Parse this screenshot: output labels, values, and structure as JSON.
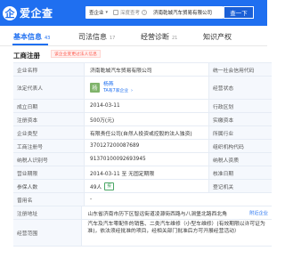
{
  "header": {
    "logo_mark": "企",
    "logo_text": "爱企查",
    "scope_label": "查企业",
    "deep_search_label": "深度查考",
    "search_value": "济南乾城汽车贸易有限公司",
    "search_button": "查一下",
    "brand_color": "#1f6ff0"
  },
  "tabs": [
    {
      "label": "基本信息",
      "count": "43"
    },
    {
      "label": "司法信息",
      "count": "17"
    },
    {
      "label": "经营诊断",
      "count": "21"
    },
    {
      "label": "知识产权",
      "count": ""
    }
  ],
  "section": {
    "title": "工商注册",
    "banner": "该企业变更过法人信息"
  },
  "rows": {
    "company_name": {
      "label": "企业名称",
      "value": "济南乾城汽车贸易有限公司",
      "right": "统一社会信用代码"
    },
    "legal_rep": {
      "label": "法定代表人",
      "avatar": "杨",
      "name": "杨燕",
      "link": "TA有7家企业",
      "right": "经营状态"
    },
    "established": {
      "label": "成立日期",
      "value": "2014-03-11",
      "right": "行政区划"
    },
    "reg_capital": {
      "label": "注册资本",
      "value": "500万(元)",
      "right": "实缴资本"
    },
    "company_type": {
      "label": "企业类型",
      "value": "有限责任公司(自然人投资或控股的法人独资)",
      "right": "所属行业"
    },
    "reg_number": {
      "label": "工商注册号",
      "value": "370127200087689",
      "right": "组织机构代码"
    },
    "tax_id": {
      "label": "纳税人识别号",
      "value": "91370100092693945",
      "right": "纳税人资质"
    },
    "term": {
      "label": "营业期限",
      "value": "2014-03-11 至 无固定期限",
      "right": "核准日期"
    },
    "insured": {
      "label": "参保人数",
      "value": "49人",
      "tag": "报",
      "right": "登记机关"
    },
    "former_name": {
      "label": "曾用名",
      "value": "-"
    },
    "address": {
      "label": "注册地址",
      "value": "山东省济南市历下区智远街道凌源街西路与八涧堡北路西北角",
      "link": "附近企业"
    },
    "scope": {
      "label": "经营范围",
      "value": "汽车及汽车零配件的销售、二类汽车维修（小型车维修）(有效期限以许可证为准)，依法须经批准的项目，经相关部门批准后方可开展经营活动）"
    }
  }
}
